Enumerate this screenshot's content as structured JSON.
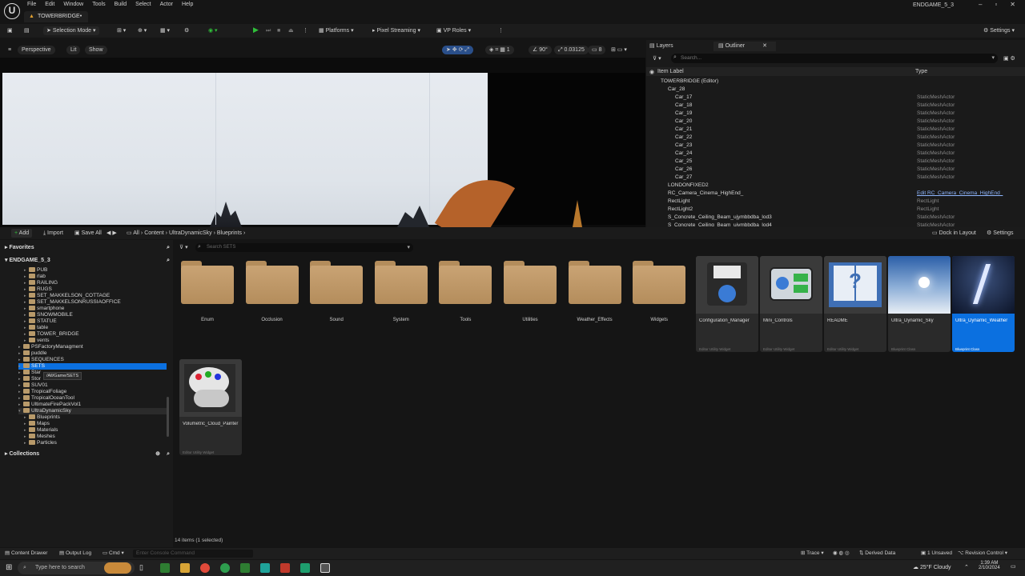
{
  "window": {
    "menu": [
      "File",
      "Edit",
      "Window",
      "Tools",
      "Build",
      "Select",
      "Actor",
      "Help"
    ],
    "project_tab": "TOWERBRIDGE•",
    "project_name": "ENDGAME_5_3"
  },
  "toolbar": {
    "selection_mode": "Selection Mode",
    "platforms": "Platforms",
    "pixel_streaming": "Pixel Streaming",
    "vp_roles": "VP Roles",
    "settings": "Settings"
  },
  "viewport": {
    "perspective": "Perspective",
    "lit": "Lit",
    "show": "Show",
    "angle": "90°",
    "scale": "0.03125",
    "cam_speed": "8"
  },
  "outliner": {
    "tab_layers": "Layers",
    "tab_outliner": "Outliner",
    "search_placeholder": "Search...",
    "col_label": "Item Label",
    "col_type": "Type",
    "rows": [
      {
        "label": "TOWERBRIDGE (Editor)",
        "type": "",
        "indent": 2
      },
      {
        "label": "Car_28",
        "type": "",
        "indent": 3
      },
      {
        "label": "Car_17",
        "type": "StaticMeshActor",
        "indent": 4
      },
      {
        "label": "Car_18",
        "type": "StaticMeshActor",
        "indent": 4
      },
      {
        "label": "Car_19",
        "type": "StaticMeshActor",
        "indent": 4
      },
      {
        "label": "Car_20",
        "type": "StaticMeshActor",
        "indent": 4
      },
      {
        "label": "Car_21",
        "type": "StaticMeshActor",
        "indent": 4
      },
      {
        "label": "Car_22",
        "type": "StaticMeshActor",
        "indent": 4
      },
      {
        "label": "Car_23",
        "type": "StaticMeshActor",
        "indent": 4
      },
      {
        "label": "Car_24",
        "type": "StaticMeshActor",
        "indent": 4
      },
      {
        "label": "Car_25",
        "type": "StaticMeshActor",
        "indent": 4
      },
      {
        "label": "Car_26",
        "type": "StaticMeshActor",
        "indent": 4
      },
      {
        "label": "Car_27",
        "type": "StaticMeshActor",
        "indent": 4
      },
      {
        "label": "LONDONFIXED2",
        "type": "",
        "indent": 3
      },
      {
        "label": "RC_Camera_Cinema_HighEnd_",
        "type": "Edit RC_Camera_Cinema_HighEnd_",
        "indent": 3,
        "link": true
      },
      {
        "label": "RectLight",
        "type": "RectLight",
        "indent": 3
      },
      {
        "label": "RectLight2",
        "type": "RectLight",
        "indent": 3
      },
      {
        "label": "S_Concrete_Ceiling_Beam_ujymbbdba_lod3",
        "type": "StaticMeshActor",
        "indent": 3
      },
      {
        "label": "S_Concrete_Ceiling_Beam_ujymbbdba_lod4",
        "type": "StaticMeshActor",
        "indent": 3
      }
    ]
  },
  "content_browser": {
    "add": "Add",
    "import": "Import",
    "save_all": "Save All",
    "breadcrumb": [
      "All",
      "Content",
      "UltraDynamicSky",
      "Blueprints"
    ],
    "dock": "Dock in Layout",
    "settings": "Settings",
    "search_placeholder": "Search SETS",
    "favorites": "Favorites",
    "root": "ENDGAME_5_3",
    "collections": "Collections",
    "tooltip": "/All/Game/SETS",
    "tree": [
      {
        "label": "PUB",
        "indent": 4
      },
      {
        "label": "rlab",
        "indent": 4
      },
      {
        "label": "RAILING",
        "indent": 4
      },
      {
        "label": "RUGS",
        "indent": 4
      },
      {
        "label": "SET_MAKKELSON_COTTAGE",
        "indent": 4
      },
      {
        "label": "SET_MAKKELSONRUSSIAOFFICE",
        "indent": 4
      },
      {
        "label": "smartphone",
        "indent": 4
      },
      {
        "label": "SNOWMOBILE",
        "indent": 4
      },
      {
        "label": "STATUE",
        "indent": 4
      },
      {
        "label": "table",
        "indent": 4
      },
      {
        "label": "TOWER_BRIDGE",
        "indent": 4
      },
      {
        "label": "vents",
        "indent": 4
      },
      {
        "label": "PSFactoryManagment",
        "indent": 3
      },
      {
        "label": "puddle",
        "indent": 3
      },
      {
        "label": "SEQUENCES",
        "indent": 3
      },
      {
        "label": "SETS",
        "indent": 3,
        "selected": true
      },
      {
        "label": "Star",
        "indent": 3
      },
      {
        "label": "Stor",
        "indent": 3
      },
      {
        "label": "SUV01",
        "indent": 3
      },
      {
        "label": "TropicalFoliage",
        "indent": 3
      },
      {
        "label": "TropicalOceanTool",
        "indent": 3
      },
      {
        "label": "UltimateFirePackVol1",
        "indent": 3
      },
      {
        "label": "UltraDynamicSky",
        "indent": 3,
        "open": true
      },
      {
        "label": "Blueprints",
        "indent": 4,
        "active": true
      },
      {
        "label": "Maps",
        "indent": 4
      },
      {
        "label": "Materials",
        "indent": 4
      },
      {
        "label": "Meshes",
        "indent": 4
      },
      {
        "label": "Particles",
        "indent": 4
      }
    ],
    "folders": [
      "Enum",
      "Occlusion",
      "Sound",
      "System",
      "Tools",
      "Utilities",
      "Weather_Effects",
      "Widgets"
    ],
    "assets": [
      {
        "name": "Configuration_Manager",
        "kind": "Editor Utility Widget",
        "icon": "floppy-gear-icon"
      },
      {
        "name": "Mini_Controls",
        "kind": "Editor Utility Widget",
        "icon": "controls-icon"
      },
      {
        "name": "README",
        "kind": "Editor Utility Widget",
        "icon": "book-question-icon"
      },
      {
        "name": "Ultra_Dynamic_Sky",
        "kind": "Blueprint Class",
        "icon": "sky-icon"
      },
      {
        "name": "Ultra_Dynamic_Weather",
        "kind": "Blueprint Class",
        "icon": "lightning-icon",
        "selected": true
      },
      {
        "name": "Volumetric_Cloud_Painter",
        "kind": "Editor Utility Widget",
        "icon": "palette-cloud-icon"
      }
    ],
    "footer": "14 items (1 selected)"
  },
  "statusbar": {
    "content_drawer": "Content Drawer",
    "output_log": "Output Log",
    "cmd": "Cmd",
    "cmd_placeholder": "Enter Console Command",
    "trace": "Trace",
    "derived_data": "Derived Data",
    "unsaved": "1 Unsaved",
    "revision": "Revision Control"
  },
  "taskbar": {
    "search_placeholder": "Type here to search",
    "weather": "25°F Cloudy",
    "time": "1:39 AM",
    "date": "2/10/2024"
  }
}
